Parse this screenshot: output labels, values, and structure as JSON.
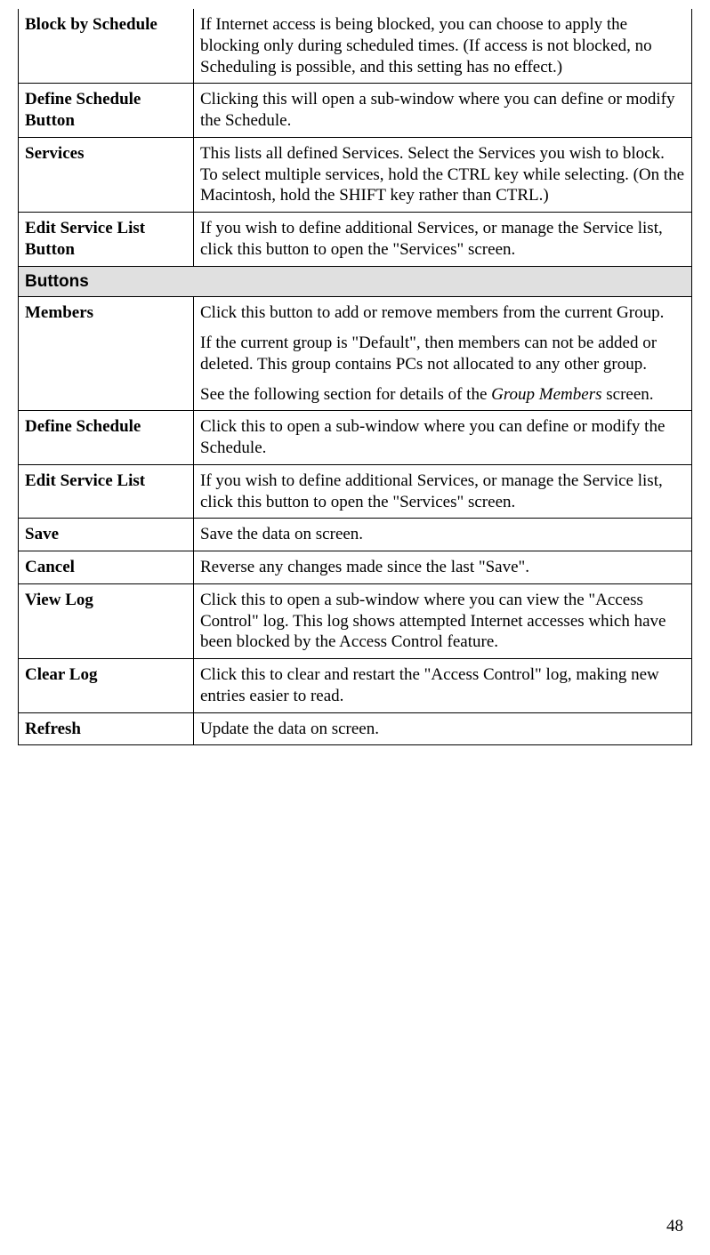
{
  "rows_top": [
    {
      "label": "Block by Schedule",
      "desc": "If Internet access is being blocked, you can choose to apply the blocking only during scheduled times. (If access is not blocked, no Scheduling is possible, and this setting has no effect.)"
    },
    {
      "label": "Define Schedule Button",
      "desc": "Clicking this will open a sub-window where you can define or modify the Schedule."
    },
    {
      "label": "Services",
      "desc": "This lists all defined Services. Select the Services you wish to block. To select multiple services, hold the CTRL key while selecting. (On the Macintosh, hold the SHIFT key rather than CTRL.)"
    },
    {
      "label": "Edit Service List Button",
      "desc": "If you wish to define additional Services, or manage the Service list, click this button to open the \"Services\" screen."
    }
  ],
  "section_header": "Buttons",
  "members": {
    "label": "Members",
    "p1": "Click this button to add or remove members from the current Group.",
    "p2": "If the current group is \"Default\", then members can not be added or deleted. This group contains PCs not allocated to any other group.",
    "p3a": "See the following section for details of the ",
    "p3i": "Group Members",
    "p3b": " screen."
  },
  "rows_bottom": [
    {
      "label": "Define Schedule",
      "desc": "Click this to open a sub-window where you can define or modify the Schedule."
    },
    {
      "label": "Edit Service List",
      "desc": "If you wish to define additional Services, or manage the Service list, click this button to open the \"Services\" screen."
    },
    {
      "label": "Save",
      "desc": "Save the data on screen."
    },
    {
      "label": "Cancel",
      "desc": "Reverse any changes made since the last \"Save\"."
    },
    {
      "label": "View Log",
      "desc": "Click this to open a sub-window where you can view the \"Access Control\" log. This log shows attempted Internet accesses which have been blocked by the Access Control feature."
    },
    {
      "label": "Clear Log",
      "desc": "Click this to clear and restart the \"Access Control\" log, making new entries easier to read."
    },
    {
      "label": "Refresh",
      "desc": "Update the data on screen."
    }
  ],
  "page_number": "48"
}
